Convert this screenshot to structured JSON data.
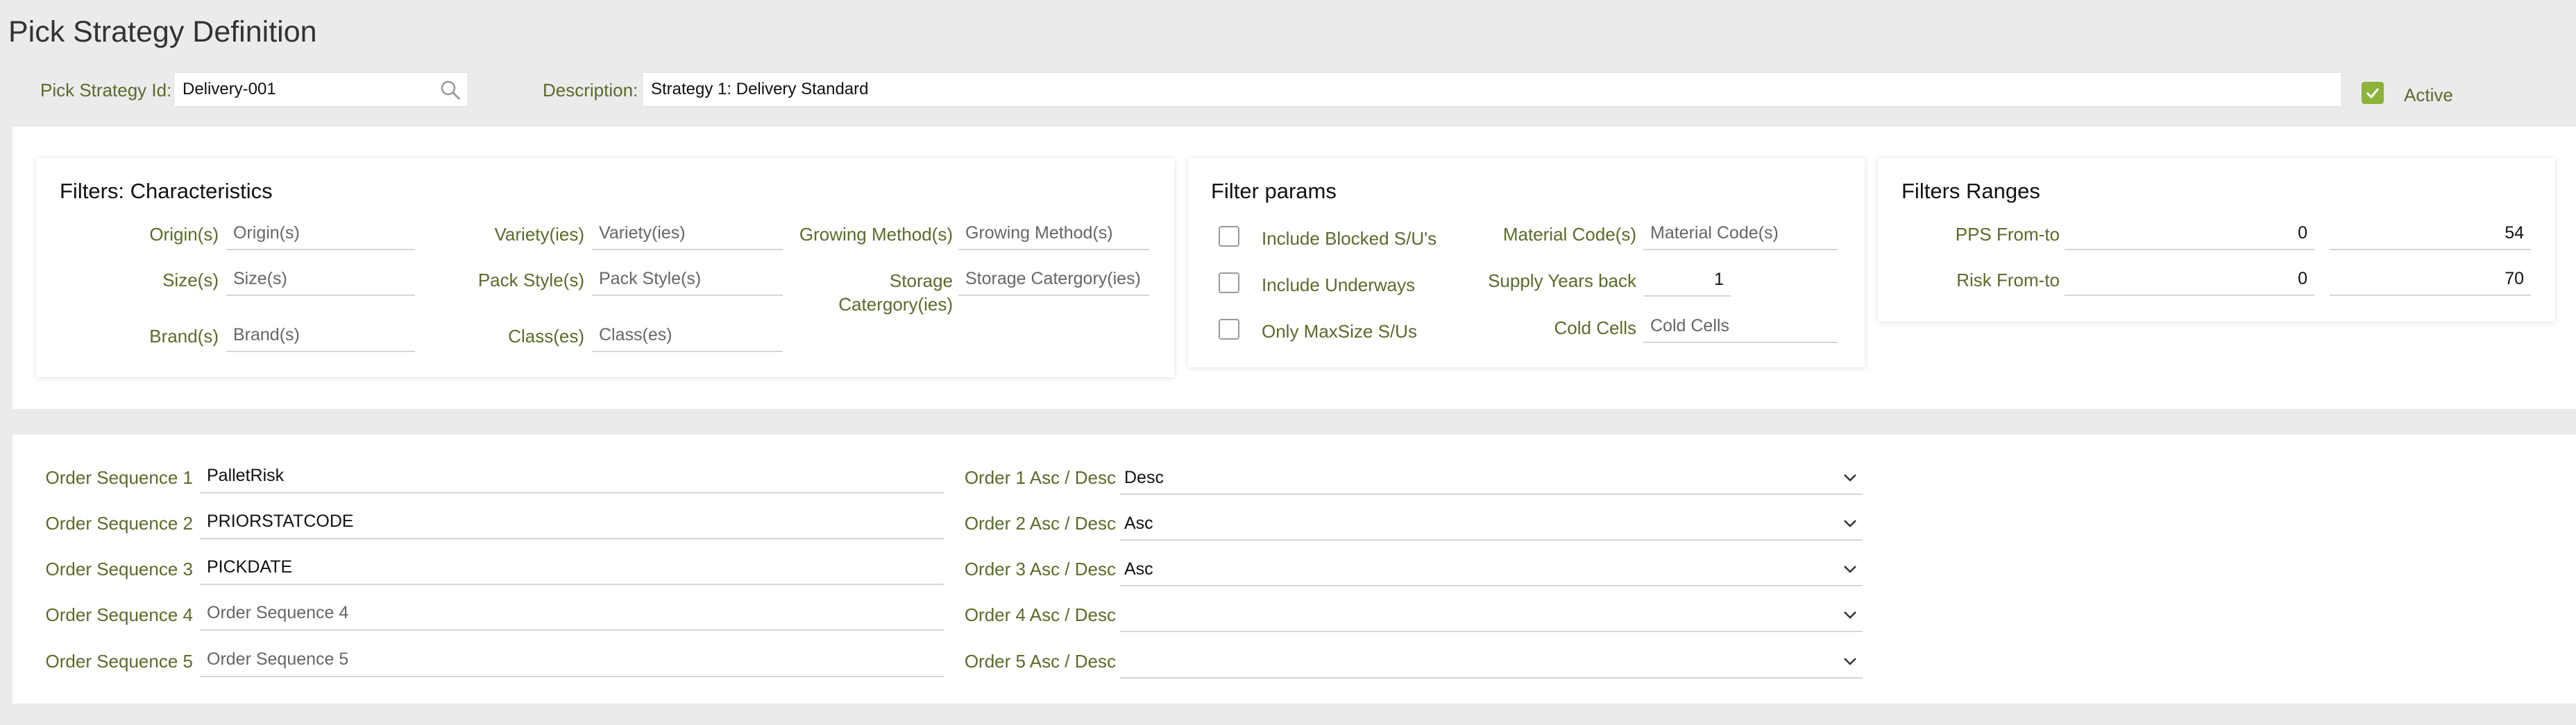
{
  "page_title": "Pick Strategy Definition",
  "header": {
    "strategy_id_label": "Pick Strategy Id:",
    "strategy_id_value": "Delivery-001",
    "description_label": "Description:",
    "description_value": "Strategy 1: Delivery Standard",
    "active_label": "Active",
    "active_checked": true
  },
  "characteristics": {
    "title": "Filters: Characteristics",
    "origin_label": "Origin(s)",
    "origin_placeholder": "Origin(s)",
    "size_label": "Size(s)",
    "size_placeholder": "Size(s)",
    "brand_label": "Brand(s)",
    "brand_placeholder": "Brand(s)",
    "variety_label": "Variety(ies)",
    "variety_placeholder": "Variety(ies)",
    "pack_label": "Pack Style(s)",
    "pack_placeholder": "Pack Style(s)",
    "class_label": "Class(es)",
    "class_placeholder": "Class(es)",
    "growing_label": "Growing Method(s)",
    "growing_placeholder": "Growing Method(s)",
    "storage_label_1": "Storage",
    "storage_label_2": "Catergory(ies)",
    "storage_placeholder": "Storage Catergory(ies)"
  },
  "filter_params": {
    "title": "Filter params",
    "include_blocked_label": "Include Blocked S/U's",
    "include_underways_label": "Include Underways",
    "only_maxsize_label": "Only MaxSize S/Us",
    "material_label": "Material Code(s)",
    "material_placeholder": "Material Code(s)",
    "supply_years_label": "Supply Years back",
    "supply_years_value": "1",
    "cold_cells_label": "Cold Cells",
    "cold_cells_placeholder": "Cold Cells"
  },
  "filter_ranges": {
    "title": "Filters Ranges",
    "pps_label": "PPS From-to",
    "pps_from": "0",
    "pps_to": "54",
    "risk_label": "Risk From-to",
    "risk_from": "0",
    "risk_to": "70"
  },
  "order_sequences": [
    {
      "label": "Order Sequence 1",
      "value": "PalletRisk",
      "placeholder": "",
      "dir_label": "Order 1 Asc / Desc",
      "dir_value": "Desc"
    },
    {
      "label": "Order Sequence 2",
      "value": "PRIORSTATCODE",
      "placeholder": "",
      "dir_label": "Order 2 Asc / Desc",
      "dir_value": "Asc"
    },
    {
      "label": "Order Sequence 3",
      "value": "PICKDATE",
      "placeholder": "",
      "dir_label": "Order 3 Asc / Desc",
      "dir_value": "Asc"
    },
    {
      "label": "Order Sequence 4",
      "value": "",
      "placeholder": "Order Sequence 4",
      "dir_label": "Order 4 Asc / Desc",
      "dir_value": ""
    },
    {
      "label": "Order Sequence 5",
      "value": "",
      "placeholder": "Order Sequence 5",
      "dir_label": "Order 5 Asc / Desc",
      "dir_value": ""
    }
  ],
  "colors": {
    "accent": "#8db33b",
    "label": "#5a6b2a",
    "background": "#ebebeb"
  }
}
